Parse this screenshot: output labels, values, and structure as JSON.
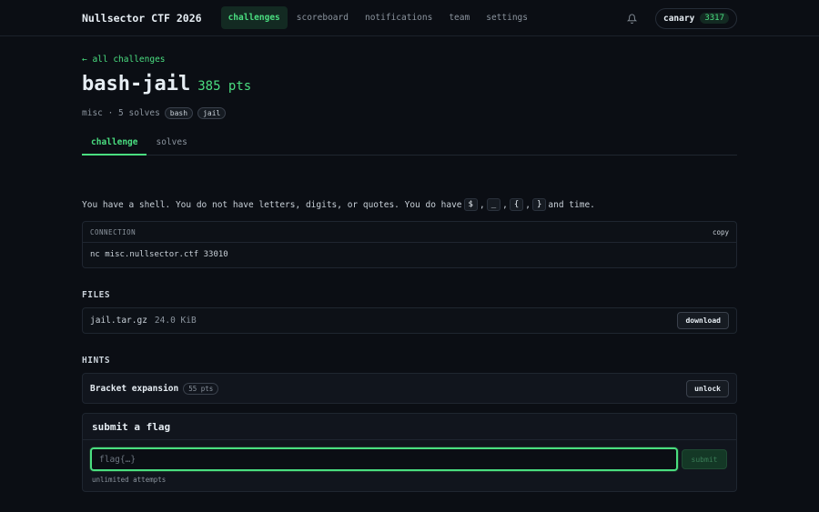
{
  "header": {
    "brand": "Nullsector CTF 2026",
    "nav": [
      "challenges",
      "scoreboard",
      "notifications",
      "team",
      "settings"
    ],
    "active_nav": "challenges",
    "user": {
      "name": "canary",
      "score": "3317"
    }
  },
  "challenge": {
    "back_link": "← all challenges",
    "title": "bash-jail",
    "points": "385 pts",
    "meta": "misc · 5 solves",
    "tags": [
      "bash",
      "jail"
    ],
    "tabs": [
      "challenge",
      "solves"
    ],
    "description_prefix": "You have a shell. You do not have letters, digits, or quotes. You do have",
    "description_chars": [
      "$",
      "_",
      "{",
      "}"
    ],
    "description_sep": ",",
    "description_suffix": "and time.",
    "connection": {
      "label": "CONNECTION",
      "copy_label": "copy",
      "command": "nc misc.nullsector.ctf 33010"
    },
    "files_heading": "FILES",
    "files": [
      {
        "name": "jail.tar.gz",
        "size": "24.0 KiB",
        "action": "download"
      }
    ],
    "hints_heading": "HINTS",
    "hints": [
      {
        "name": "Bracket expansion",
        "cost": "55 pts",
        "action": "unlock"
      }
    ],
    "submit": {
      "heading": "submit a flag",
      "placeholder": "flag{…}",
      "button": "submit",
      "attempts": "unlimited attempts"
    }
  },
  "colors": {
    "accent": "#4ade80",
    "background": "#0b0e14"
  }
}
